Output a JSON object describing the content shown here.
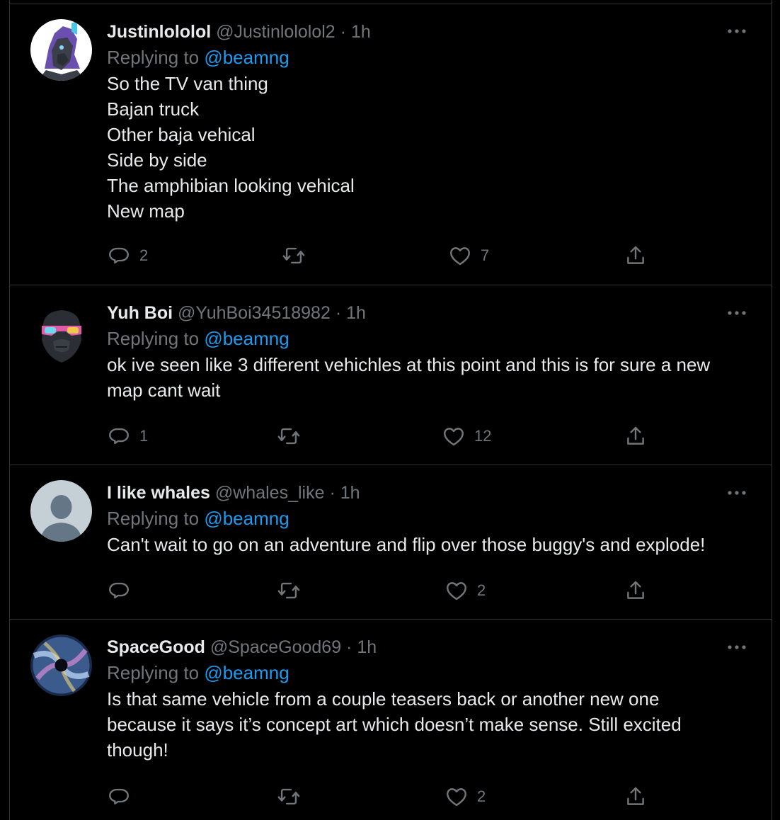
{
  "replying_prefix": "Replying to",
  "colors": {
    "background": "#000000",
    "text": "#e7e9ea",
    "secondary": "#71767b",
    "link": "#1d9bf0",
    "divider": "#2f3336"
  },
  "tweets": [
    {
      "display_name": "Justinlololol",
      "handle": "@Justinlololol2",
      "time": "1h",
      "replying_to": "@beamng",
      "lines": [
        "So the TV van thing",
        "Bajan truck",
        "Other baja vehical",
        "Side by side",
        "The amphibian looking vehical",
        "New map"
      ],
      "reply_count": "2",
      "retweet_count": "",
      "like_count": "7",
      "avatar_icon": "purple-horse-character-icon"
    },
    {
      "display_name": "Yuh Boi",
      "handle": "@YuhBoi34518982",
      "time": "1h",
      "replying_to": "@beamng",
      "lines": [
        "ok ive seen like 3 different vehichles at this point and this is for sure a new",
        "map cant wait"
      ],
      "reply_count": "1",
      "retweet_count": "",
      "like_count": "12",
      "avatar_icon": "gorilla-sunglasses-icon"
    },
    {
      "display_name": "I like whales",
      "handle": "@whales_like",
      "time": "1h",
      "replying_to": "@beamng",
      "lines": [
        "Can't wait to go on an adventure and flip over those buggy's and explode!"
      ],
      "reply_count": "",
      "retweet_count": "",
      "like_count": "2",
      "avatar_icon": "default-user-icon"
    },
    {
      "display_name": "SpaceGood",
      "handle": "@SpaceGood69",
      "time": "1h",
      "replying_to": "@beamng",
      "lines": [
        "Is that same vehicle from a couple teasers back or another new one",
        "because it says it’s concept art which doesn’t make sense. Still excited",
        "though!"
      ],
      "reply_count": "",
      "retweet_count": "",
      "like_count": "2",
      "avatar_icon": "galaxy-swirl-icon"
    }
  ]
}
